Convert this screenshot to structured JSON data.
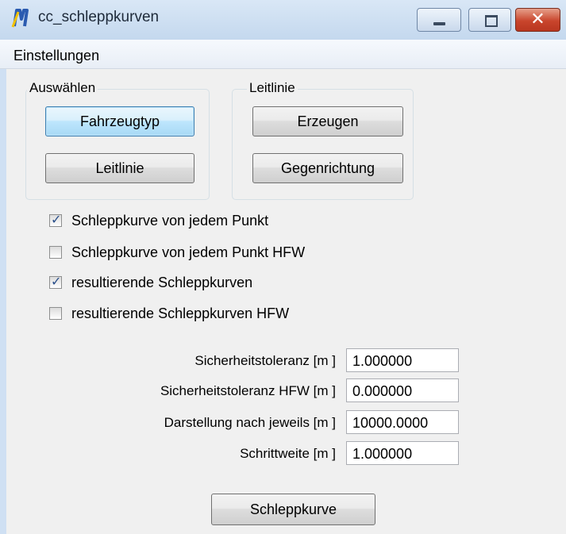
{
  "window": {
    "title": "cc_schleppkurven",
    "close_glyph": "✕"
  },
  "menu": {
    "items": [
      {
        "label": "Einstellungen"
      }
    ]
  },
  "groups": {
    "auswaehlen": {
      "label": "Auswählen",
      "buttons": [
        {
          "label": "Fahrzeugtyp"
        },
        {
          "label": "Leitlinie"
        }
      ]
    },
    "leitlinie": {
      "label": "Leitlinie",
      "buttons": [
        {
          "label": "Erzeugen"
        },
        {
          "label": "Gegenrichtung"
        }
      ]
    }
  },
  "options": [
    {
      "label": "Schleppkurve von jedem Punkt",
      "checked": true
    },
    {
      "label": "Schleppkurve von jedem Punkt HFW",
      "checked": false
    },
    {
      "label": "resultierende Schleppkurven",
      "checked": true
    },
    {
      "label": "resultierende Schleppkurven HFW",
      "checked": false
    }
  ],
  "check_glyph": "✓",
  "fields": [
    {
      "label": "Sicherheitstoleranz [m ]",
      "value": "1.000000"
    },
    {
      "label": "Sicherheitstoleranz HFW [m ]",
      "value": "0.000000"
    },
    {
      "label": "Darstellung nach jeweils [m ]",
      "value": "10000.0000"
    },
    {
      "label": "Schrittweite [m ]",
      "value": "1.000000"
    }
  ],
  "actions": {
    "run_label": "Schleppkurve"
  },
  "colors": {
    "close_button": "#c9452c",
    "app_icon_blue": "#2b5bb0",
    "app_icon_yellow": "#f2c200"
  }
}
